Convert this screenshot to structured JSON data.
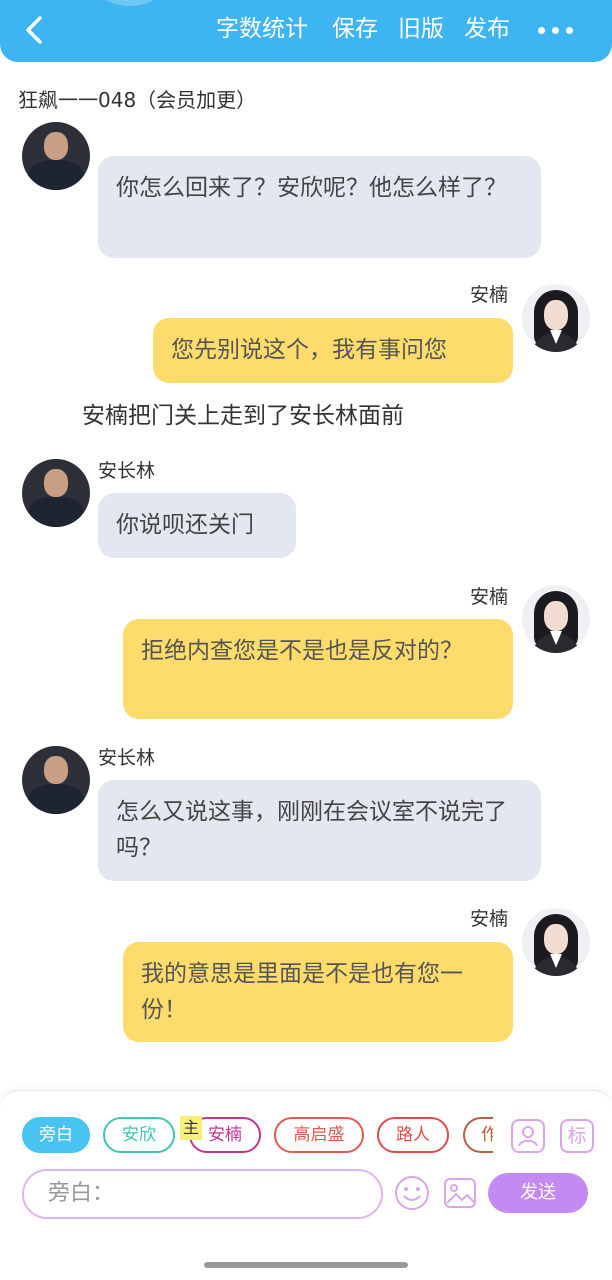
{
  "header": {
    "word_count_label": "字数统计",
    "save_label": "保存",
    "old_version_label": "旧版",
    "publish_label": "发布"
  },
  "story_title": "狂飙一一048（会员加更）",
  "messages": [
    {
      "speaker": "安长林",
      "text": "你怎么回来了？安欣呢？他怎么样了？"
    },
    {
      "speaker": "安楠",
      "text": "您先别说这个，我有事问您"
    },
    {
      "narration": "安楠把门关上走到了安长林面前"
    },
    {
      "speaker": "安长林",
      "text": "你说呗还关门"
    },
    {
      "speaker": "安楠",
      "text": "拒绝内查您是不是也是反对的？"
    },
    {
      "speaker": "安长林",
      "text": "怎么又说这事，刚刚在会议室不说完了吗？"
    },
    {
      "speaker": "安楠",
      "text": "我的意思是里面是不是也有您一份！"
    }
  ],
  "characters": [
    {
      "label": "旁白",
      "color": "#49c3f1"
    },
    {
      "label": "安欣",
      "color": "#3cc6b4"
    },
    {
      "label": "安楠",
      "color": "#c2358f",
      "badge": "主"
    },
    {
      "label": "高启盛",
      "color": "#e05a4f"
    },
    {
      "label": "路人",
      "color": "#e04b4b"
    },
    {
      "label": "作",
      "color": "#b5603e"
    }
  ],
  "tools": {
    "role_icon": "person-card-icon",
    "mark_label": "标"
  },
  "input": {
    "placeholder": "旁白："
  },
  "send_label": "发送",
  "colors": {
    "header": "#3fb4f3",
    "gray_bubble": "#e3e7ef",
    "yellow_bubble": "#fedc6c",
    "send": "#c48af3"
  }
}
